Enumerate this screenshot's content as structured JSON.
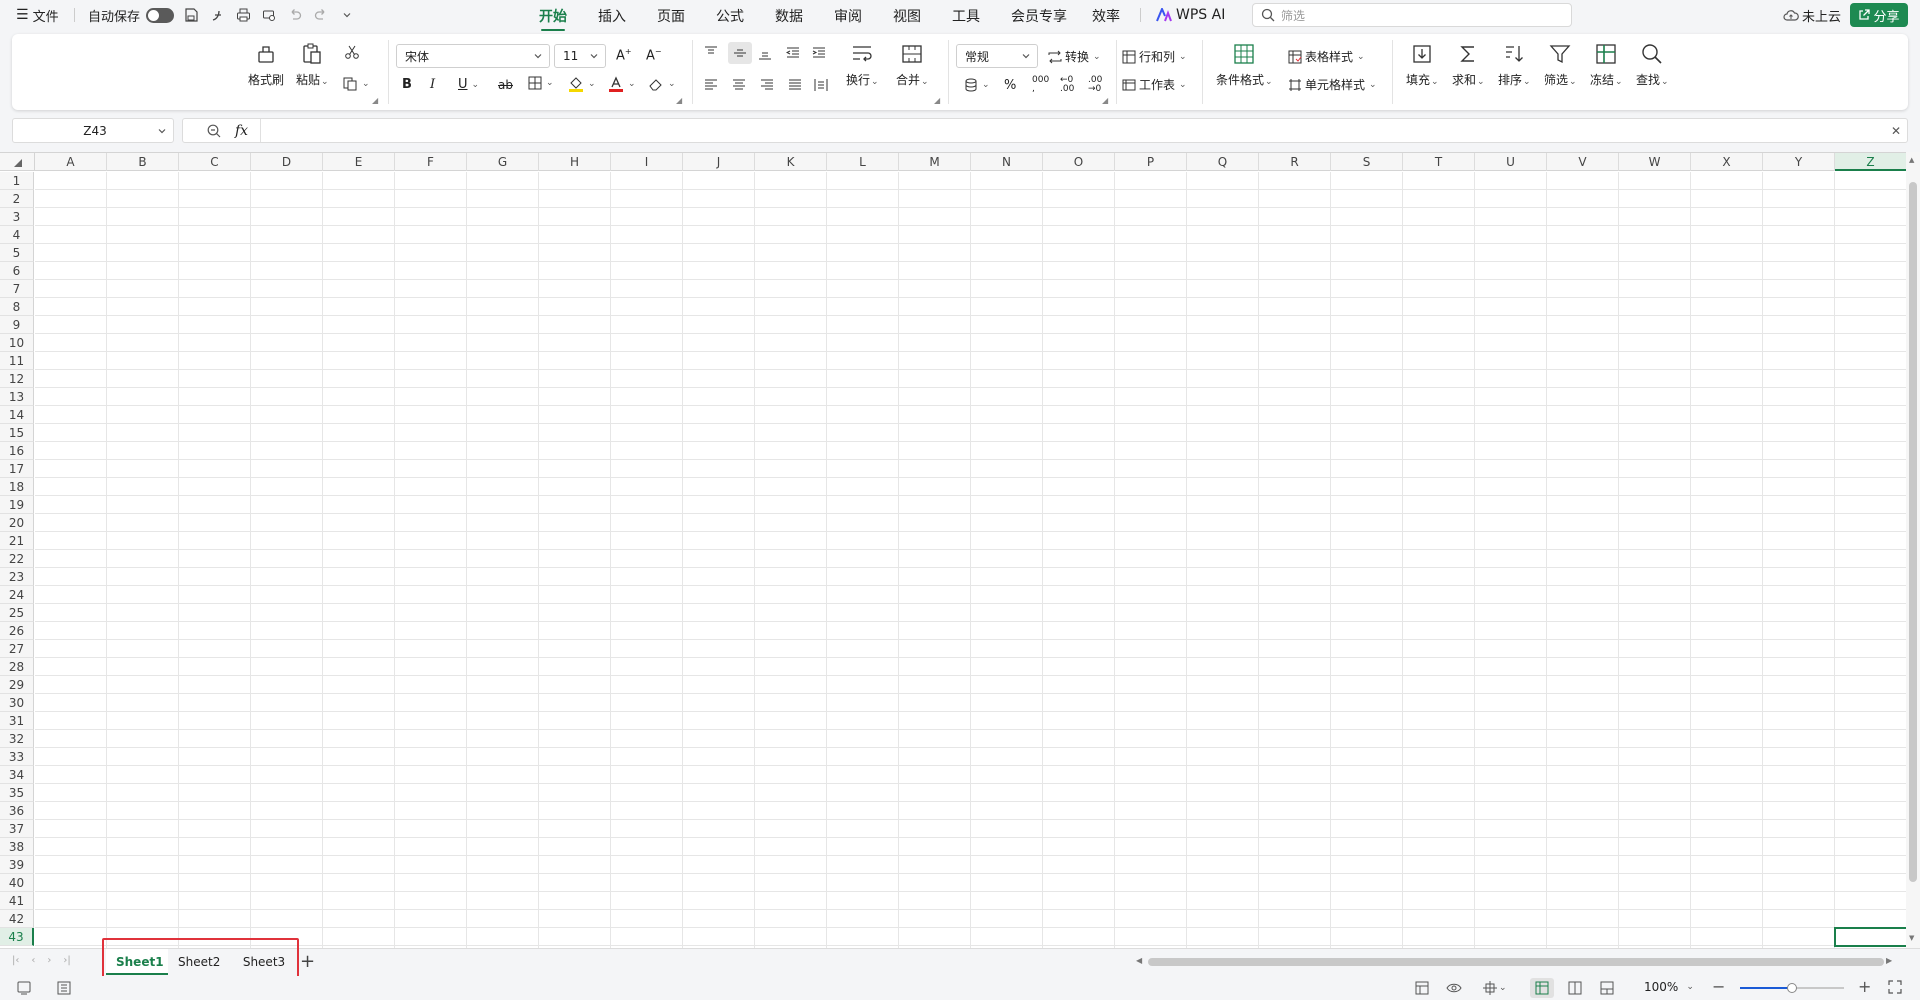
{
  "titlebar": {
    "file_menu": "文件",
    "autosave_label": "自动保存",
    "tabs": [
      "开始",
      "插入",
      "页面",
      "公式",
      "数据",
      "审阅",
      "视图",
      "工具",
      "会员专享",
      "效率"
    ],
    "active_tab": "开始",
    "wps_ai": "WPS AI",
    "search_placeholder": "筛选",
    "cloud_status": "未上云",
    "share": "分享"
  },
  "ribbon": {
    "format_painter": "格式刷",
    "paste": "粘贴",
    "font_name": "宋体",
    "font_size": "11",
    "wrap_text": "换行",
    "merge": "合并",
    "number_format": "常规",
    "convert": "转换",
    "rows_cols": "行和列",
    "worksheet": "工作表",
    "conditional_format": "条件格式",
    "table_style": "表格样式",
    "cell_style": "单元格样式",
    "fill": "填充",
    "sum": "求和",
    "sort": "排序",
    "filter": "筛选",
    "freeze": "冻结",
    "find": "查找",
    "bold": "B",
    "italic": "I",
    "underline": "U",
    "strike": "ab",
    "percent": "%"
  },
  "formula": {
    "namebox": "Z43",
    "fx": "fx",
    "value": ""
  },
  "grid": {
    "columns": [
      "A",
      "B",
      "C",
      "D",
      "E",
      "F",
      "G",
      "H",
      "I",
      "J",
      "K",
      "L",
      "M",
      "N",
      "O",
      "P",
      "Q",
      "R",
      "S",
      "T",
      "U",
      "V",
      "W",
      "X",
      "Y",
      "Z"
    ],
    "row_count": 43,
    "selected_cell": "Z43"
  },
  "sheets": {
    "tabs": [
      "Sheet1",
      "Sheet2",
      "Sheet3"
    ],
    "active": "Sheet1",
    "add": "+"
  },
  "statusbar": {
    "zoom": "100%"
  }
}
